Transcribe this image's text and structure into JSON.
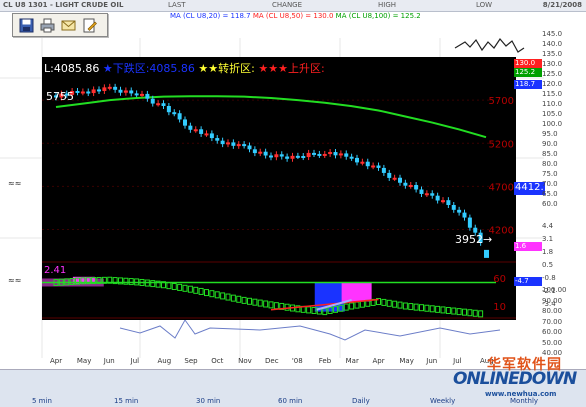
{
  "topbar": {
    "symbol": "CL U8 1301 - LIGHT CRUDE OIL",
    "last": "LAST",
    "change": "CHANGE",
    "high": "HIGH",
    "low": "LOW",
    "date": "8/21/2008"
  },
  "ma_line": {
    "ma20": "MA (CL U8,20) = 118.7",
    "ma50": "MA (CL U8,50) = 130.0",
    "ma100": "MA (CL U8,100) = 125.2",
    "colors": {
      "ma20": "#1a33ff",
      "ma50": "#ff2020",
      "ma100": "#00c000"
    }
  },
  "toolbar": {
    "icons": [
      "save-icon",
      "print-icon",
      "email-icon",
      "edit-icon"
    ]
  },
  "main_panel": {
    "header_value": "L:4085.86",
    "down_stars": "★",
    "down_text": "下跌区:4085.86",
    "turn_stars": "★★",
    "turn_text": "转折区:",
    "up_stars": "★★★",
    "up_text": "上升区:",
    "start_label": "5755",
    "end_label": "3952",
    "end_arrow": "→",
    "current_price": "4412.",
    "colors": {
      "background": "#000000",
      "up_candle": "#ff3030",
      "down_candle": "#33ccff",
      "ma_line": "#22dd22",
      "axis_text": "#b50000"
    }
  },
  "osc_panel": {
    "label": "2.41",
    "ticks": [
      "60",
      "10"
    ]
  },
  "right_scale": {
    "price_ticks": [
      "145.0",
      "140.0",
      "135.0",
      "130.0",
      "125.0",
      "120.0",
      "115.0",
      "110.0",
      "105.0",
      "100.0",
      "95.0",
      "90.0",
      "85.0",
      "80.0",
      "75.0",
      "70.0",
      "65.0",
      "60.0"
    ],
    "ma50_badge": "130.0",
    "ma100_badge": "125.2",
    "ma20_badge": "118.7",
    "ind_ticks": [
      "4.4",
      "3.1",
      "1.8",
      "0.5",
      "-0.8",
      "-2.1",
      "-3.4"
    ],
    "ind_badge1": "1.6",
    "ind_badge2": "-4.7",
    "rsi_ticks": [
      "100.00",
      "90.00",
      "80.00",
      "70.00",
      "60.00",
      "50.00",
      "40.00"
    ]
  },
  "months": [
    "Apr",
    "May",
    "Jun",
    "Jul",
    "Aug",
    "Sep",
    "Oct",
    "Nov",
    "Dec",
    "'08",
    "Feb",
    "Mar",
    "Apr",
    "May",
    "Jun",
    "Jul",
    "Aug"
  ],
  "bottombar": {
    "tabs": [
      "5 min",
      "15 min",
      "30 min",
      "60 min",
      "Daily",
      "Weekly",
      "Monthly"
    ]
  },
  "watermark": {
    "cn": "华军软件园",
    "logo": "ONLINEDOWN",
    "url": "www.newhua.com"
  },
  "chart_data": {
    "type": "line",
    "title": "CL U8 1301 - LIGHT CRUDE OIL",
    "x": [
      "Apr",
      "May",
      "Jun",
      "Jul",
      "Aug",
      "Sep",
      "Oct",
      "Nov",
      "Dec",
      "'08",
      "Feb",
      "Mar",
      "Apr",
      "May",
      "Jun",
      "Jul",
      "Aug"
    ],
    "series": [
      {
        "name": "price",
        "values": [
          5755,
          5800,
          5830,
          5780,
          5620,
          5380,
          5230,
          5150,
          5050,
          5040,
          5100,
          5030,
          4890,
          4720,
          4580,
          4420,
          3952
        ]
      },
      {
        "name": "ma",
        "values": [
          5620,
          5660,
          5700,
          5725,
          5740,
          5745,
          5745,
          5740,
          5725,
          5700,
          5670,
          5630,
          5580,
          5510,
          5440,
          5360,
          5270
        ]
      }
    ],
    "ylim": [
      3800,
      6200
    ],
    "yticks": [
      5700,
      5200,
      4700,
      4200
    ],
    "annotations": [
      "5755",
      "3952"
    ],
    "oscillator": {
      "ylim": [
        -15,
        85
      ],
      "ticks": [
        60,
        10
      ],
      "signal_level": 52,
      "line": [
        52,
        55,
        56,
        53,
        48,
        40,
        30,
        20,
        12,
        5,
        0,
        10,
        18,
        10,
        5,
        0,
        -5
      ],
      "bars": [
        {
          "x_index": 10,
          "color": "#1a33ff",
          "from": 0,
          "to": 52
        },
        {
          "x_index": 11,
          "color": "#ff33ff",
          "from": 18,
          "to": 52
        }
      ]
    }
  }
}
